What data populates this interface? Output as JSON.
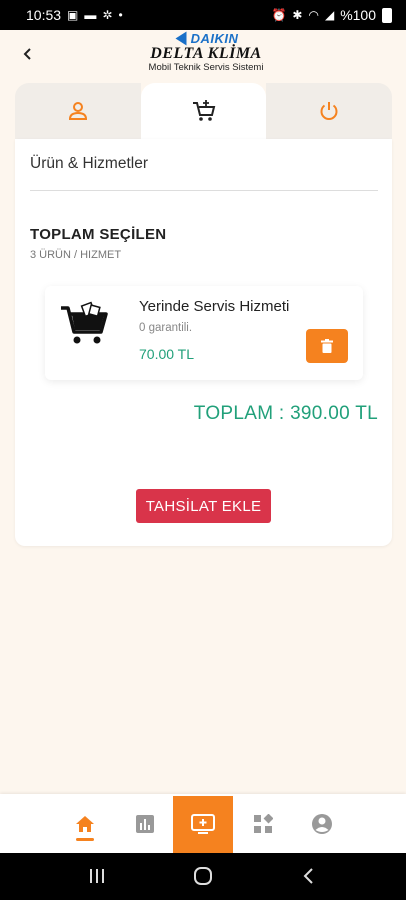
{
  "status_bar": {
    "time": "10:53",
    "battery": "%100",
    "icons": [
      "image-icon",
      "message-icon",
      "settings-icon",
      "dot-icon",
      "alarm-icon",
      "bluetooth-icon",
      "wifi-icon",
      "signal-icon",
      "battery-icon"
    ]
  },
  "header": {
    "brand": "DAIKIN",
    "company": "DELTA KLİMA",
    "subtitle": "Mobil Teknik Servis Sistemi"
  },
  "tabs": [
    {
      "icon": "user-icon",
      "active": false
    },
    {
      "icon": "cart-add-icon",
      "active": true
    },
    {
      "icon": "power-icon",
      "active": false
    }
  ],
  "main": {
    "section_title": "Ürün & Hizmetler",
    "summary_title": "TOPLAM SEÇİLEN",
    "summary_sub": "3 ÜRÜN / HIZMET",
    "item": {
      "name": "Yerinde Servis Hizmeti",
      "warranty": "0 garantili.",
      "price": "70.00 TL"
    },
    "total": "TOPLAM : 390.00 TL",
    "collect_button": "TAHSİLAT EKLE"
  },
  "bottom_nav": [
    {
      "icon": "home-icon",
      "active": true
    },
    {
      "icon": "chart-icon",
      "active": false
    },
    {
      "icon": "monitor-add-icon",
      "active": false
    },
    {
      "icon": "apps-icon",
      "active": false
    },
    {
      "icon": "account-icon",
      "active": false
    }
  ],
  "colors": {
    "accent": "#f5821f",
    "price_green": "#21a07a",
    "button_red": "#d9344a",
    "daikin_blue": "#1a70c8"
  }
}
